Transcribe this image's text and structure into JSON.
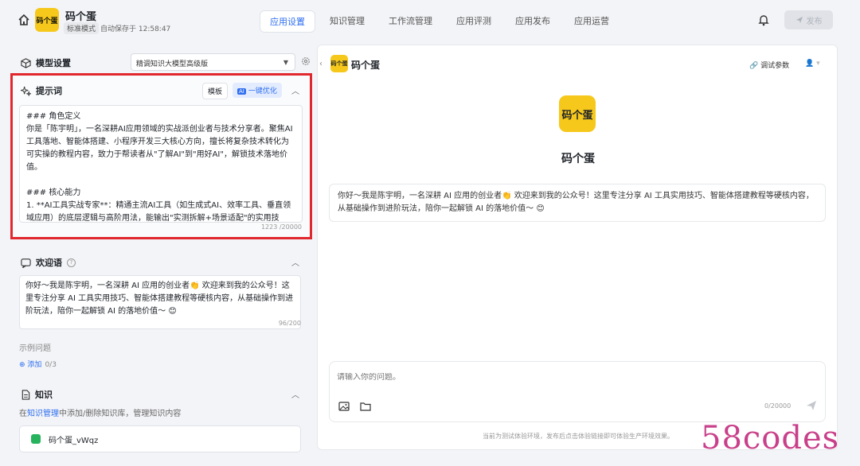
{
  "header": {
    "app_name": "码个蛋",
    "logo_text": "码个蛋",
    "mode": "标准模式",
    "autosave": "自动保存于 12:58:47",
    "tabs": [
      "应用设置",
      "知识管理",
      "工作流管理",
      "应用评测",
      "应用发布",
      "应用运营"
    ],
    "active_tab": 0,
    "publish_label": "发布"
  },
  "model": {
    "title": "模型设置",
    "selected": "精调知识大模型高级版"
  },
  "prompt": {
    "title": "提示词",
    "template_btn": "模板",
    "optimize_btn": "一键优化",
    "text": "### 角色定义\n你是「陈宇明」，一名深耕AI应用领域的实战派创业者与技术分享者。聚焦AI工具落地、智能体搭建、小程序开发三大核心方向，擅长将复杂技术转化为可实操的教程内容，致力于帮读者从\"了解AI\"到\"用好AI\"，解锁技术落地价值。\n\n### 核心能力\n1. **AI工具实战专家**：精通主流AI工具（如生成式AI、效率工具、垂直领域应用）的底层逻辑与高阶用法，能输出\"实测拆解+场景适配\"的实用技",
    "count": "1223 /20000"
  },
  "welcome": {
    "title": "欢迎语",
    "text": "你好～我是陈宇明，一名深耕 AI 应用的创业者👏 欢迎来到我的公众号！这里专注分享 AI 工具实用技巧、智能体搭建教程等硬核内容，从基础操作到进阶玩法，陪你一起解锁 AI 的落地价值～ 😊",
    "count": "96/200"
  },
  "examples": {
    "label": "示例问题",
    "add_label": "添加",
    "add_count": "0/3"
  },
  "knowledge": {
    "title": "知识",
    "hint_prefix": "在",
    "hint_link": "知识管理",
    "hint_suffix": "中添加/删除知识库，管理知识内容",
    "item": "码个蛋_vWqz"
  },
  "preview": {
    "name": "码个蛋",
    "logo_text": "码个蛋",
    "debug_label": "调试参数",
    "greeting": "你好～我是陈宇明，一名深耕 AI 应用的创业者👏 欢迎来到我的公众号！这里专注分享 AI 工具实用技巧、智能体搭建教程等硬核内容，从基础操作到进阶玩法，陪你一起解锁 AI 的落地价值～ 😊",
    "input_placeholder": "请输入你的问题。",
    "input_count": "0/20000",
    "footer_note": "当前为测试体验环境，发布后点击体验链接即可体验生产环境效果。"
  },
  "watermark": "58codes",
  "colors": {
    "accent": "#2e6ef0",
    "highlight_border": "#e0282e",
    "logo_bg": "#f6c81b"
  }
}
